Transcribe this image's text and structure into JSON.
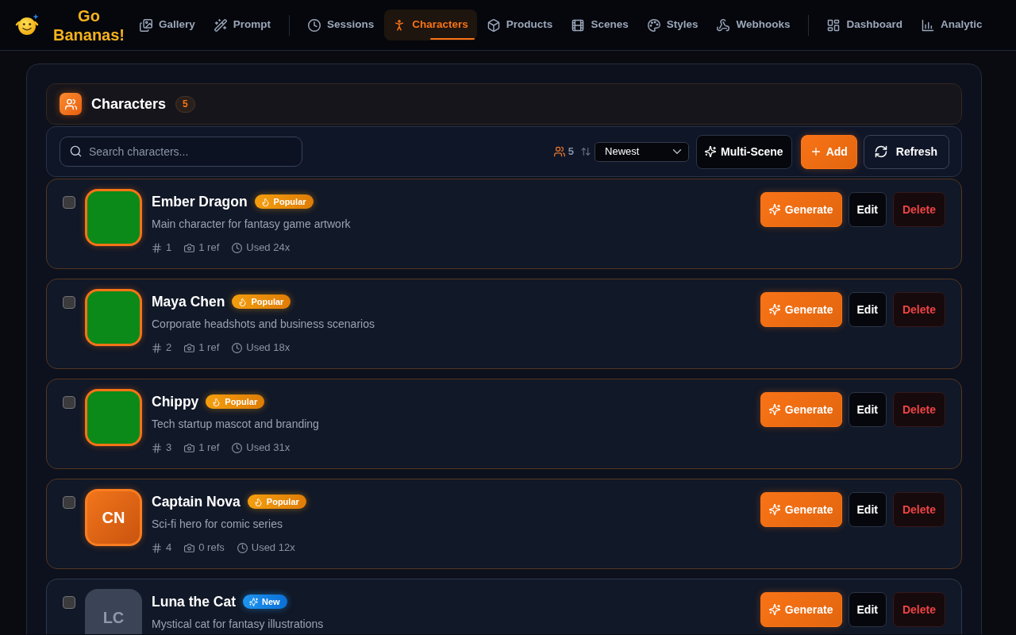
{
  "app": {
    "logo": "Go Bananas!"
  },
  "nav_groups": [
    [
      {
        "label": "Gallery",
        "selected": false
      },
      {
        "label": "Prompt",
        "selected": false
      }
    ],
    [
      {
        "label": "Sessions",
        "selected": false
      },
      {
        "label": "Characters",
        "selected": true
      },
      {
        "label": "Products",
        "selected": false
      },
      {
        "label": "Scenes",
        "selected": false
      },
      {
        "label": "Styles",
        "selected": false
      },
      {
        "label": "Webhooks",
        "selected": false
      }
    ],
    [
      {
        "label": "Dashboard",
        "selected": false
      },
      {
        "label": "Analytic",
        "selected": false
      }
    ]
  ],
  "header": {
    "title": "Characters",
    "count": "5"
  },
  "toolbar": {
    "search": {
      "placeholder": "Search characters..."
    },
    "total": "5",
    "sort": {
      "value": "Newest"
    },
    "buttons": [
      {
        "label": "Multi-Scene",
        "kind": "dark"
      },
      {
        "label": "Add",
        "kind": "primary"
      },
      {
        "label": "Refresh",
        "kind": "outline"
      }
    ]
  },
  "characters": [
    {
      "checked": false,
      "avatar": {
        "kind": "image"
      },
      "name": "Ember Dragon",
      "badge": {
        "kind": "popular",
        "label": "Popular"
      },
      "description": "Main character for fantasy game artwork",
      "meta": {
        "number": "1",
        "refs": "1 ref",
        "used": "Used 24x"
      },
      "actions": [
        {
          "label": "Generate",
          "kind": "primary"
        },
        {
          "label": "Edit",
          "kind": "dark"
        },
        {
          "label": "Delete",
          "kind": "danger"
        }
      ]
    },
    {
      "checked": false,
      "avatar": {
        "kind": "image"
      },
      "name": "Maya Chen",
      "badge": {
        "kind": "popular",
        "label": "Popular"
      },
      "description": "Corporate headshots and business scenarios",
      "meta": {
        "number": "2",
        "refs": "1 ref",
        "used": "Used 18x"
      },
      "actions": [
        {
          "label": "Generate",
          "kind": "primary"
        },
        {
          "label": "Edit",
          "kind": "dark"
        },
        {
          "label": "Delete",
          "kind": "danger"
        }
      ]
    },
    {
      "checked": false,
      "avatar": {
        "kind": "image"
      },
      "name": "Chippy",
      "badge": {
        "kind": "popular",
        "label": "Popular"
      },
      "description": "Tech startup mascot and branding",
      "meta": {
        "number": "3",
        "refs": "1 ref",
        "used": "Used 31x"
      },
      "actions": [
        {
          "label": "Generate",
          "kind": "primary"
        },
        {
          "label": "Edit",
          "kind": "dark"
        },
        {
          "label": "Delete",
          "kind": "danger"
        }
      ]
    },
    {
      "checked": false,
      "avatar": {
        "kind": "initials",
        "text": "CN"
      },
      "name": "Captain Nova",
      "badge": {
        "kind": "popular",
        "label": "Popular"
      },
      "description": "Sci-fi hero for comic series",
      "meta": {
        "number": "4",
        "refs": "0 refs",
        "used": "Used 12x"
      },
      "actions": [
        {
          "label": "Generate",
          "kind": "primary"
        },
        {
          "label": "Edit",
          "kind": "dark"
        },
        {
          "label": "Delete",
          "kind": "danger"
        }
      ]
    },
    {
      "checked": false,
      "avatar": {
        "kind": "initials",
        "text": "LC"
      },
      "name": "Luna the Cat",
      "badge": {
        "kind": "new",
        "label": "New"
      },
      "description": "Mystical cat for fantasy illustrations",
      "actions": [
        {
          "label": "Generate",
          "kind": "primary"
        },
        {
          "label": "Edit",
          "kind": "dark"
        },
        {
          "label": "Delete",
          "kind": "danger"
        }
      ]
    }
  ]
}
